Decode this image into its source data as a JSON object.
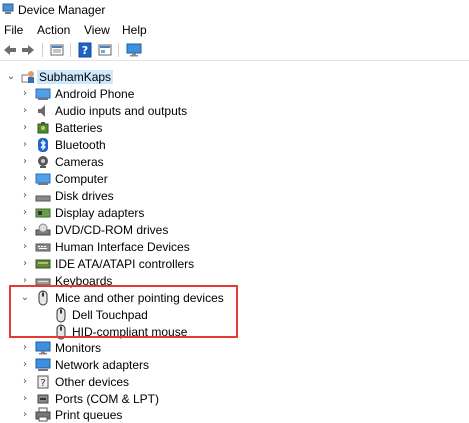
{
  "window": {
    "title": "Device Manager"
  },
  "menu": [
    "File",
    "Action",
    "View",
    "Help"
  ],
  "toolbar": {
    "buttons": [
      "back-icon",
      "forward-icon",
      "properties-icon",
      "help-icon",
      "update-driver-icon",
      "monitor-icon"
    ]
  },
  "tree": {
    "root": "SubhamKaps",
    "categories": [
      {
        "label": "Android Phone",
        "icon": "phone-icon"
      },
      {
        "label": "Audio inputs and outputs",
        "icon": "speaker-icon"
      },
      {
        "label": "Batteries",
        "icon": "battery-icon"
      },
      {
        "label": "Bluetooth",
        "icon": "bluetooth-icon"
      },
      {
        "label": "Cameras",
        "icon": "camera-icon"
      },
      {
        "label": "Computer",
        "icon": "computer-icon"
      },
      {
        "label": "Disk drives",
        "icon": "disk-icon"
      },
      {
        "label": "Display adapters",
        "icon": "display-adapter-icon"
      },
      {
        "label": "DVD/CD-ROM drives",
        "icon": "dvd-icon"
      },
      {
        "label": "Human Interface Devices",
        "icon": "hid-icon"
      },
      {
        "label": "IDE ATA/ATAPI controllers",
        "icon": "ide-icon"
      },
      {
        "label": "Keyboards",
        "icon": "keyboard-icon"
      },
      {
        "label": "Mice and other pointing devices",
        "icon": "mouse-icon",
        "expanded": true,
        "children": [
          {
            "label": "Dell Touchpad",
            "icon": "mouse-icon"
          },
          {
            "label": "HID-compliant mouse",
            "icon": "mouse-icon"
          }
        ]
      },
      {
        "label": "Monitors",
        "icon": "monitor-icon"
      },
      {
        "label": "Network adapters",
        "icon": "network-icon"
      },
      {
        "label": "Other devices",
        "icon": "other-devices-icon"
      },
      {
        "label": "Ports (COM & LPT)",
        "icon": "port-icon"
      },
      {
        "label": "Print queues",
        "icon": "printer-icon"
      }
    ]
  },
  "colors": {
    "highlight_border": "#e53935",
    "selection_bg": "#cce8ff"
  }
}
